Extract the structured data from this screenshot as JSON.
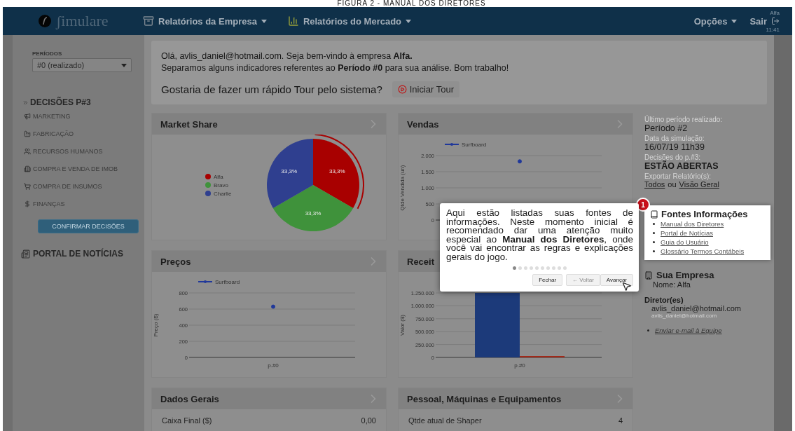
{
  "caption": "FIGURA 2 - MANUAL DOS DIRETORES",
  "navbar": {
    "logo": "ʃimulare",
    "menus": [
      {
        "label": "Relatórios da Empresa"
      },
      {
        "label": "Relatórios do Mercado"
      }
    ],
    "options": "Opções",
    "logout": "Sair",
    "user": "Alfa",
    "time": "11:41"
  },
  "sidebar": {
    "periods_label": "PERÍODOS",
    "period_select": "#0 (realizado)",
    "decisions_heading": "DECISÕES P#3",
    "items": [
      {
        "label": "MARKETING"
      },
      {
        "label": "FABRICAÇÃO"
      },
      {
        "label": "RECURSOS HUMANOS"
      },
      {
        "label": "COMPRA E VENDA DE IMOB"
      },
      {
        "label": "COMPRA DE INSUMOS"
      },
      {
        "label": "FINANÇAS"
      }
    ],
    "confirm_button": "CONFIRMAR DECISÕES",
    "news_portal": "PORTAL DE NOTÍCIAS"
  },
  "welcome": {
    "lines": [
      "Olá, avlis_daniel@hotmail.com. Seja bem-vindo à empresa **Alfa.**",
      "Separamos alguns indicadores referentes ao **Período #0** para sua análise. Bom trabalho!"
    ],
    "tour_question": "Gostaria de fazer um rápido Tour pelo sistema?",
    "tour_button": "Iniciar Tour"
  },
  "columns": [
    [
      {
        "title": "Market Share",
        "kind": "chart",
        "chart_data": {
          "type": "pie",
          "categories": [
            "Alfa",
            "Bravo",
            "Charlie"
          ],
          "series": [
            {
              "values": [
                33.3,
                33.3,
                33.3
              ]
            }
          ],
          "colors": [
            "#a80000",
            "#3f923b",
            "#2f3f8f"
          ],
          "value_labels": [
            "33,3%",
            "33,3%",
            "33,3%"
          ],
          "legend": true
        }
      },
      {
        "title": "Preços",
        "kind": "chart",
        "chart_data": {
          "type": "line",
          "ylabel": "Preço ($)",
          "categories": [
            "p.#0"
          ],
          "series": [
            {
              "name": "Surfboard",
              "color": "#20389a",
              "values": [
                630
              ],
              "marker": true
            }
          ],
          "ylim": [
            0,
            800
          ],
          "yticks": [
            0,
            200,
            400,
            600,
            800
          ],
          "grid": true,
          "legend": true
        }
      },
      {
        "title": "Dados Gerais",
        "kind": "table",
        "rows": [
          {
            "label": "Caixa Final ($)",
            "value": "0,00"
          }
        ]
      }
    ],
    [
      {
        "title": "Vendas",
        "kind": "chart",
        "chart_data": {
          "type": "line",
          "ylabel": "Qtde Vendida (un)",
          "series": [
            {
              "name": "Surfboard",
              "color": "#20389a",
              "values": [
                1820
              ],
              "marker": true
            }
          ],
          "ylim": [
            0,
            2000
          ],
          "yticks": [
            0,
            {
              "value": 500,
              "label": "500"
            },
            {
              "value": 1000,
              "label": "1.000"
            },
            {
              "value": 1500,
              "label": "1.500"
            },
            {
              "value": 2000,
              "label": "2.000"
            }
          ],
          "grid": true,
          "legend": true
        }
      },
      {
        "title": "Receit",
        "kind": "chart",
        "chart_data": {
          "type": "bar",
          "ylabel": "Valor ($)",
          "categories": [
            "p.#0"
          ],
          "series": [
            {
              "color": "#1c3a7a",
              "values": [
                1250000
              ]
            },
            {
              "color": "#a02a1a",
              "values": [
                10000
              ]
            }
          ],
          "ylim": [
            0,
            1250000
          ],
          "yticks": [
            0,
            {
              "value": 250000,
              "label": "250.000"
            },
            {
              "value": 500000,
              "label": "500.000"
            },
            {
              "value": 750000,
              "label": "750.000"
            },
            {
              "value": 1000000,
              "label": "1.000.000"
            },
            {
              "value": 1250000,
              "label": "1.250.000"
            }
          ],
          "grid": true
        }
      },
      {
        "title": "Pessoal, Máquinas e Equipamentos",
        "kind": "table",
        "rows": [
          {
            "label": "Qtde atual de Shaper",
            "value": "4"
          }
        ]
      }
    ]
  ],
  "info": {
    "facts": [
      {
        "label": "Último período realizado:",
        "value": "Período #2",
        "kind": "plain"
      },
      {
        "label": "Data da simulação:",
        "value": "16/07/19 11h39",
        "kind": "plain"
      },
      {
        "label": "Decisões do p.#3:",
        "value": "ESTÃO ABERTAS",
        "kind": "strong"
      }
    ],
    "export_label": "Exportar Relatório(s):",
    "export_links": [
      "Todos",
      "Visão Geral"
    ],
    "export_joiner": "ou",
    "sources": {
      "badge": "1",
      "title": "Fontes Informações",
      "links": [
        "Manual dos Diretores",
        "Portal de Notícias",
        "Guia do Usuário",
        "Glossário Termos Contábeis"
      ]
    },
    "company": {
      "title": "Sua Empresa",
      "name": "Nome: Alfa",
      "directors_label": "Diretor(es)",
      "director": "avlis_daniel@hotmail.com",
      "director_sub": "avlis_daniel@hotmail.com",
      "email_link": "Enviar e-mail à Equipe"
    }
  },
  "tour_popover": {
    "text": "Aqui estão listadas suas fontes de informações. Neste momento inicial é recomendado dar uma atenção muito especial ao **Manual dos Diretores**, onde você vai encontrar as regras e explicações gerais do jogo.",
    "steps": [
      {
        "selected": true
      },
      {
        "selected": false
      },
      {
        "selected": false
      },
      {
        "selected": false
      },
      {
        "selected": false
      },
      {
        "selected": false
      },
      {
        "selected": false
      },
      {
        "selected": false
      },
      {
        "selected": false
      },
      {
        "selected": false
      }
    ],
    "buttons": [
      {
        "label": "Fechar",
        "disabled": false
      },
      {
        "label": "← Voltar",
        "disabled": true
      },
      {
        "label": "Avançar",
        "disabled": false
      }
    ]
  }
}
